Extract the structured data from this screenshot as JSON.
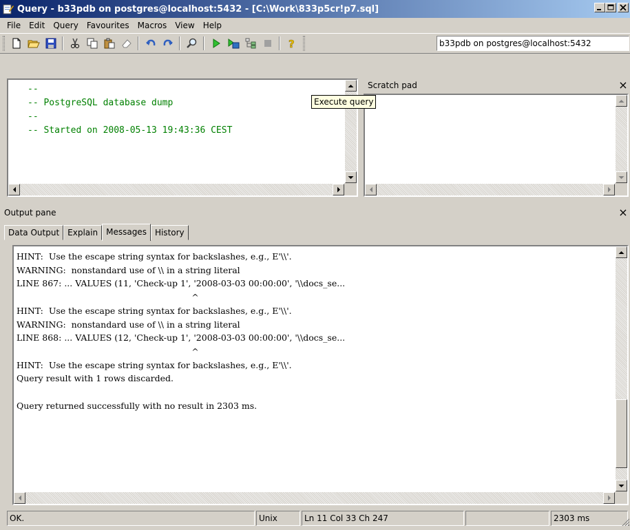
{
  "window": {
    "title": "Query - b33pdb on postgres@localhost:5432 - [C:\\Work\\833p5cr!p7.sql]",
    "minimize": "_",
    "maximize": "□",
    "close": "×"
  },
  "menu": [
    {
      "label": "File"
    },
    {
      "label": "Edit"
    },
    {
      "label": "Query"
    },
    {
      "label": "Favourites"
    },
    {
      "label": "Macros"
    },
    {
      "label": "View"
    },
    {
      "label": "Help"
    }
  ],
  "toolbar": {
    "buttons": [
      "new-file",
      "open-file",
      "save-file",
      "cut",
      "copy",
      "paste",
      "clear",
      "undo",
      "redo",
      "find",
      "execute-query",
      "execute-to-file",
      "explain-query",
      "cancel-query",
      "help"
    ],
    "connection": "b33pdb on postgres@localhost:5432",
    "tooltip": "Execute query"
  },
  "editor": {
    "lines": [
      "--",
      "-- PostgreSQL database dump",
      "--",
      "",
      "-- Started on 2008-05-13 19:43:36 CEST",
      ""
    ]
  },
  "scratch_pad": {
    "title": "Scratch pad",
    "close": "×"
  },
  "output_pane": {
    "title": "Output pane",
    "close": "×",
    "tabs": [
      {
        "label": "Data Output",
        "active": false
      },
      {
        "label": "Explain",
        "active": false
      },
      {
        "label": "Messages",
        "active": true
      },
      {
        "label": "History",
        "active": false
      }
    ],
    "messages": [
      "HINT:  Use the escape string syntax for backslashes, e.g., E'\\\\'.",
      "WARNING:  nonstandard use of \\\\ in a string literal",
      "LINE 867: ... VALUES (11, 'Check-up 1', '2008-03-03 00:00:00', '\\\\docs_se...",
      "                                                                ^",
      "HINT:  Use the escape string syntax for backslashes, e.g., E'\\\\'.",
      "WARNING:  nonstandard use of \\\\ in a string literal",
      "LINE 868: ... VALUES (12, 'Check-up 1', '2008-03-03 00:00:00', '\\\\docs_se...",
      "                                                                ^",
      "HINT:  Use the escape string syntax for backslashes, e.g., E'\\\\'.",
      "Query result with 1 rows discarded.",
      "",
      "Query returned successfully with no result in 2303 ms."
    ]
  },
  "statusbar": {
    "status": "OK.",
    "line_endings": "Unix",
    "position": "Ln 11 Col 33 Ch 247",
    "empty": "",
    "elapsed": "2303 ms"
  }
}
